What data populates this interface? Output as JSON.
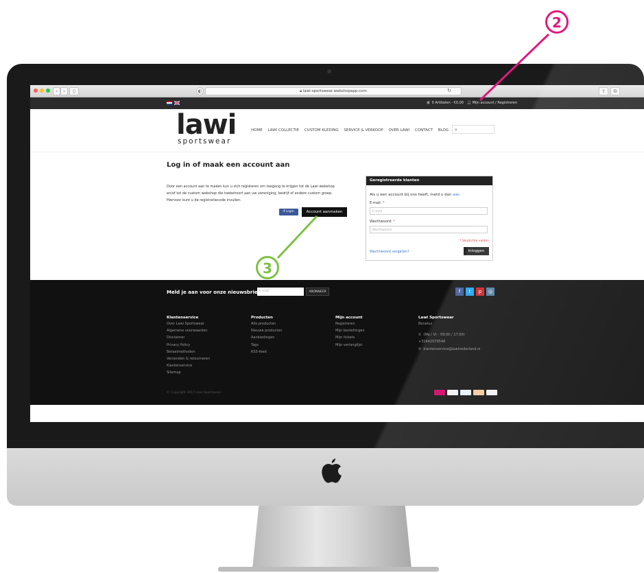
{
  "browser": {
    "url": "lawi-sportswear.webshopapp.com"
  },
  "topbar": {
    "cart_text": "0 Artikelen - €0,00",
    "account_text": "Mijn account / Registreren"
  },
  "brand": {
    "logo_main": "lawi",
    "logo_sub": "sportswear"
  },
  "nav": {
    "items": [
      "HOME",
      "LAWI COLLECTIE",
      "CUSTOM KLEDING",
      "SERVICE & VERKOOP",
      "OVER LAWI",
      "CONTACT",
      "BLOG"
    ]
  },
  "main": {
    "title": "Log in of maak een account aan",
    "intro": "Door een account aan te maken kun u zich registeren om toegang te krijgen tot de Lawi webshop en/of tot de custom webshop die toebehoort aan uw vereniging, bedrijf of andere custom groep. Hiervoor kunt u de registratiecode invullen.",
    "fb_login": "Login",
    "create_account": "Account aanmaken"
  },
  "login": {
    "heading": "Geregistreerde klanten",
    "text_prefix": "Als u een account bij ons heeft, meld u dan",
    "text_link": "aan.",
    "email_label": "E-mail:",
    "email_placeholder": "E-mail",
    "password_label": "Wachtwoord:",
    "password_placeholder": "Wachtwoord",
    "required_note": "* Verplichte velden",
    "forgot": "Wachtwoord vergeten?",
    "submit": "Inloggen"
  },
  "footer": {
    "newsletter_label": "Meld je aan voor onze nieuwsbrief:",
    "newsletter_placeholder": "E-mail",
    "newsletter_button": "ABONNEER",
    "columns": [
      {
        "title": "Klantenservice",
        "items": [
          "Over Lawi Sportswear",
          "Algemene voorwaarden",
          "Disclaimer",
          "Privacy Policy",
          "Betaalmethoden",
          "Verzenden & retourneren",
          "Klantenservice",
          "Sitemap"
        ]
      },
      {
        "title": "Producten",
        "items": [
          "Alle producten",
          "Nieuwe producten",
          "Aanbiedingen",
          "Tags",
          "RSS-feed"
        ]
      },
      {
        "title": "Mijn account",
        "items": [
          "Registreren",
          "Mijn bestellingen",
          "Mijn tickets",
          "Mijn verlanglijst"
        ]
      },
      {
        "title": "Lawi Sportswear",
        "items": [
          "Benelux"
        ]
      }
    ],
    "contact_hours": "(Ma / Vr - 09:00 / 17:00)",
    "contact_phone": "+31642079548",
    "contact_email": "klantenservice@lawinederland.nl",
    "copyright": "© Copyright 2017 Lawi Sportswear -"
  },
  "annotations": {
    "callout_2": "2",
    "callout_3": "3",
    "color_2": "#e0197d",
    "color_3": "#7cc242"
  }
}
